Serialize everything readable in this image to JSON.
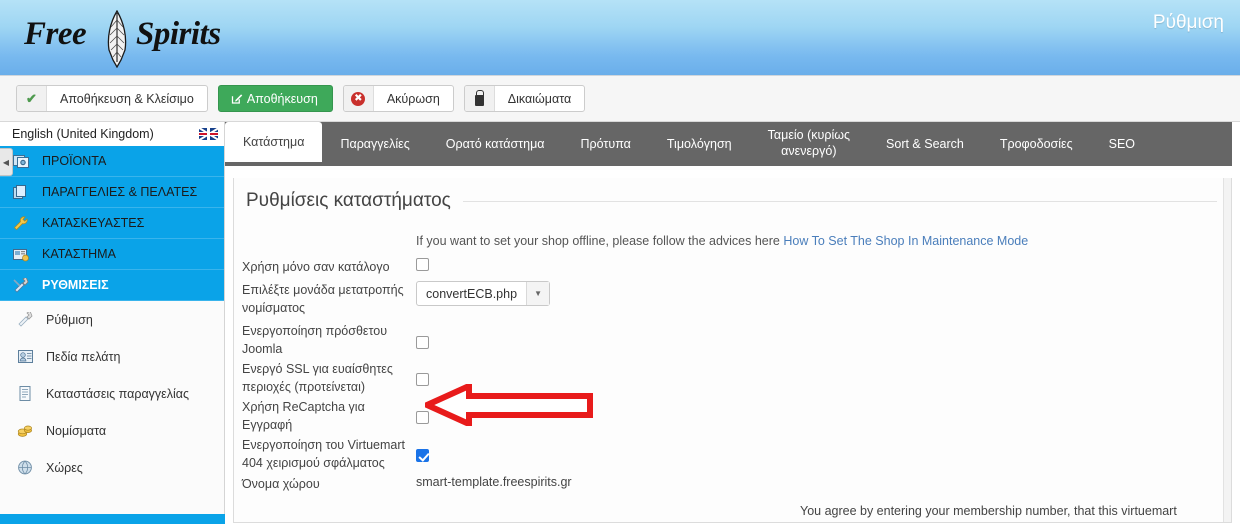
{
  "header": {
    "logo_free": "Free",
    "logo_spirits": "Spirits",
    "title": "Ρύθμιση",
    "feather_icon": "feather-icon"
  },
  "toolbar": {
    "buttons": [
      {
        "label": "Αποθήκευση & Κλείσιμο",
        "icon": "check-icon",
        "style": "default"
      },
      {
        "label": "Αποθήκευση",
        "icon": "pencil-square-icon",
        "style": "green"
      },
      {
        "label": "Ακύρωση",
        "icon": "cancel-circle-icon",
        "style": "default"
      },
      {
        "label": "Δικαιώματα",
        "icon": "lock-icon",
        "style": "default"
      }
    ]
  },
  "sidebar": {
    "language": "English (United Kingdom)",
    "flag_icon": "uk-flag-icon",
    "collapse_icon": "chevron-left-icon",
    "main_items": [
      {
        "label": "ΠΡΟΪΟΝΤΑ",
        "icon": "products-icon",
        "active": false
      },
      {
        "label": "ΠΑΡΑΓΓΕΛΙΕΣ & ΠΕΛΑΤΕΣ",
        "icon": "orders-customers-icon",
        "active": false
      },
      {
        "label": "ΚΑΤΑΣΚΕΥΑΣΤΕΣ",
        "icon": "wrench-icon",
        "active": false
      },
      {
        "label": "ΚΑΤΑΣΤΗΜΑ",
        "icon": "shop-icon",
        "active": false
      },
      {
        "label": "ΡΥΘΜΙΣΕΙΣ",
        "icon": "settings-icon",
        "active": true
      }
    ],
    "sub_items": [
      {
        "label": "Ρύθμιση",
        "icon": "configuration-icon"
      },
      {
        "label": "Πεδία πελάτη",
        "icon": "customer-fields-icon"
      },
      {
        "label": "Καταστάσεις παραγγελίας",
        "icon": "order-status-icon"
      },
      {
        "label": "Νομίσματα",
        "icon": "coins-icon"
      },
      {
        "label": "Χώρες",
        "icon": "globe-icon"
      }
    ]
  },
  "tabs": [
    {
      "label": "Κατάστημα",
      "active": true
    },
    {
      "label": "Παραγγελίες",
      "active": false
    },
    {
      "label": "Ορατό κατάστημα",
      "active": false
    },
    {
      "label": "Πρότυπα",
      "active": false
    },
    {
      "label": "Τιμολόγηση",
      "active": false
    },
    {
      "label": "Ταμείο (κυρίως",
      "label2": "ανενεργό)",
      "active": false
    },
    {
      "label": "Sort & Search",
      "active": false
    },
    {
      "label": "Τροφοδοσίες",
      "active": false
    },
    {
      "label": "SEO",
      "active": false
    }
  ],
  "panel": {
    "title": "Ρυθμίσεις καταστήματος",
    "offline_note_text": "If you want to set your shop offline, please follow the advices here ",
    "offline_note_link": "How To Set The Shop In Maintenance Mode",
    "rows": [
      {
        "label": "Χρήση μόνο σαν κατάλογο",
        "type": "checkbox",
        "checked": false
      },
      {
        "label": "Επιλέξτε μονάδα μετατροπής νομίσματος",
        "type": "select",
        "value": "convertECB.php"
      },
      {
        "label": "Ενεργοποίηση πρόσθετου Joomla",
        "type": "checkbox",
        "checked": false
      },
      {
        "label": "Ενεργό SSL για ευαίσθητες περιοχές (προτείνεται)",
        "type": "checkbox",
        "checked": false
      },
      {
        "label": "Χρήση ReCaptcha για Εγγραφή",
        "type": "checkbox",
        "checked": false
      },
      {
        "label": "Ενεργοποίηση του Virtuemart 404 χειρισμού σφάλματος",
        "type": "checkbox",
        "checked": true
      },
      {
        "label": "Όνομα χώρου",
        "type": "text",
        "value": "smart-template.freespirits.gr"
      }
    ],
    "agree_note": "You agree by entering your membership number, that this virtuemart"
  },
  "annotation": {
    "arrow": "left-pointing-red-arrow",
    "color": "#e81b1b"
  }
}
